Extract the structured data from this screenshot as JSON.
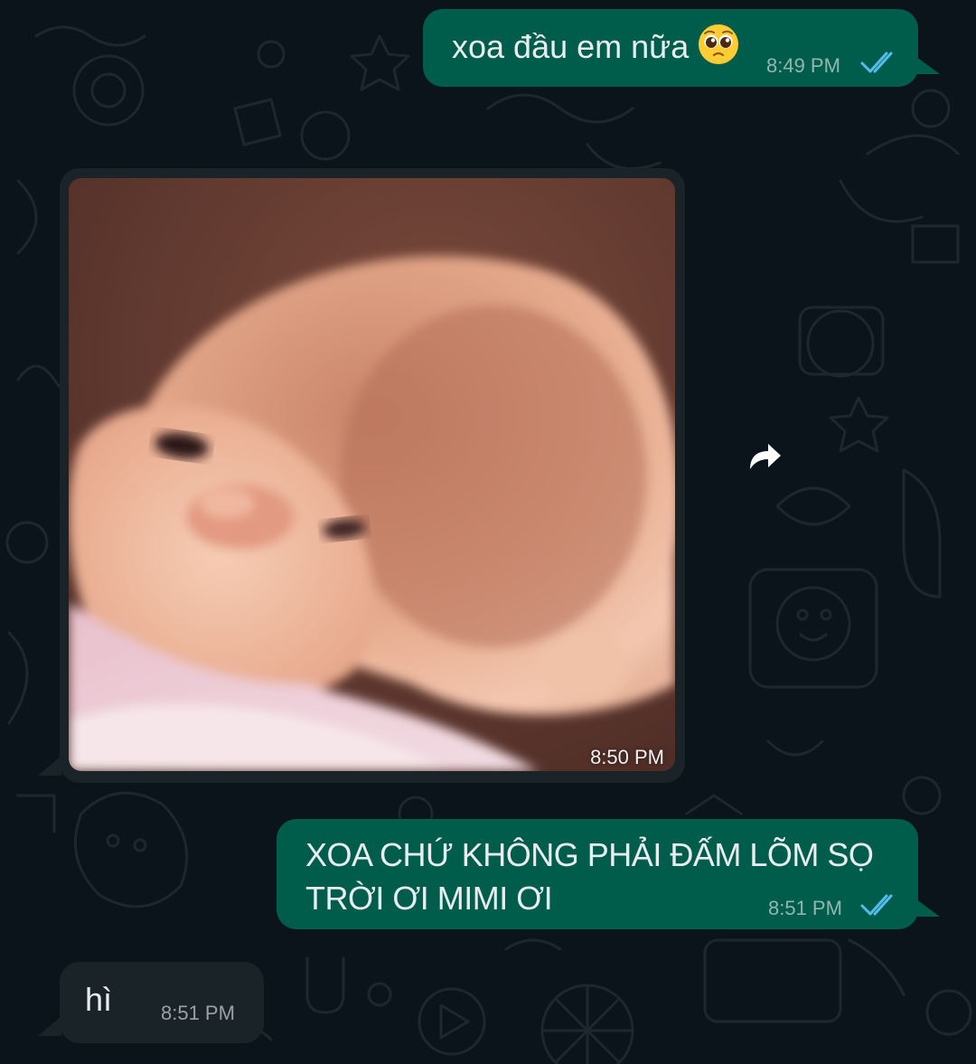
{
  "chat": {
    "messages": [
      {
        "direction": "outgoing",
        "text": "xoa đầu em nữa",
        "emoji": "pleading-face",
        "time": "8:49 PM",
        "status": "read"
      },
      {
        "direction": "incoming",
        "type": "image",
        "image_description": "blurry close-up of a baby doll with a large head",
        "time": "8:50 PM"
      },
      {
        "direction": "outgoing",
        "text_line1": "XOA CHỨ KHÔNG PHẢI ĐẤM LÕM SỌ",
        "text_line2": "TRỜI ƠI MIMI ƠI",
        "time": "8:51 PM",
        "status": "read"
      },
      {
        "direction": "incoming",
        "text": "hì",
        "time": "8:51 PM"
      }
    ]
  },
  "icons": {
    "forward": "forward-arrow-icon",
    "read_receipt": "double-check-icon"
  },
  "colors": {
    "background": "#0b141a",
    "outgoing_bubble": "#005c4b",
    "incoming_bubble": "#202c33",
    "read_tick": "#53bdeb",
    "text": "#e9edef"
  }
}
